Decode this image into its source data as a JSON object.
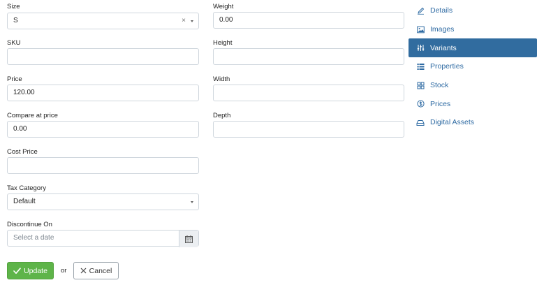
{
  "form": {
    "size": {
      "label": "Size",
      "value": "S",
      "clear": "×"
    },
    "sku": {
      "label": "SKU",
      "value": ""
    },
    "price": {
      "label": "Price",
      "value": "120.00"
    },
    "compare_at_price": {
      "label": "Compare at price",
      "value": "0.00"
    },
    "cost_price": {
      "label": "Cost Price",
      "value": ""
    },
    "tax_category": {
      "label": "Tax Category",
      "value": "Default"
    },
    "discontinue_on": {
      "label": "Discontinue On",
      "placeholder": "Select a date"
    },
    "weight": {
      "label": "Weight",
      "value": "0.00"
    },
    "height": {
      "label": "Height",
      "value": ""
    },
    "width": {
      "label": "Width",
      "value": ""
    },
    "depth": {
      "label": "Depth",
      "value": ""
    }
  },
  "actions": {
    "update_label": "Update",
    "or_text": "or",
    "cancel_label": "Cancel"
  },
  "sidebar": {
    "items": [
      {
        "label": "Details",
        "icon": "pencil-icon",
        "active": false
      },
      {
        "label": "Images",
        "icon": "image-icon",
        "active": false
      },
      {
        "label": "Variants",
        "icon": "sliders-icon",
        "active": true
      },
      {
        "label": "Properties",
        "icon": "list-icon",
        "active": false
      },
      {
        "label": "Stock",
        "icon": "grid-icon",
        "active": false
      },
      {
        "label": "Prices",
        "icon": "dollar-icon",
        "active": false
      },
      {
        "label": "Digital Assets",
        "icon": "hdd-icon",
        "active": false
      }
    ]
  },
  "colors": {
    "accent": "#316c9f",
    "link": "#2f6ba3",
    "success": "#5eb449"
  }
}
